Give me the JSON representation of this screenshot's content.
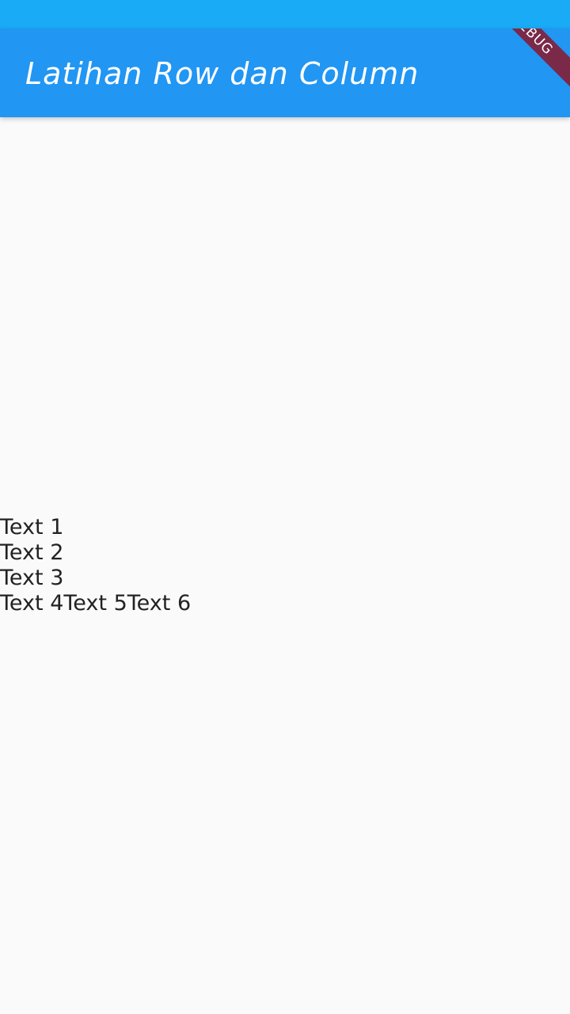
{
  "app_bar": {
    "title": "Latihan Row dan Column",
    "color": "#2196f3",
    "status_bar_color": "#1aabf6"
  },
  "debug_banner": {
    "label": "DEBUG"
  },
  "column": {
    "items": [
      "Text 1",
      "Text 2",
      "Text 3"
    ],
    "row": [
      "Text 4",
      "Text 5",
      "Text 6"
    ]
  }
}
